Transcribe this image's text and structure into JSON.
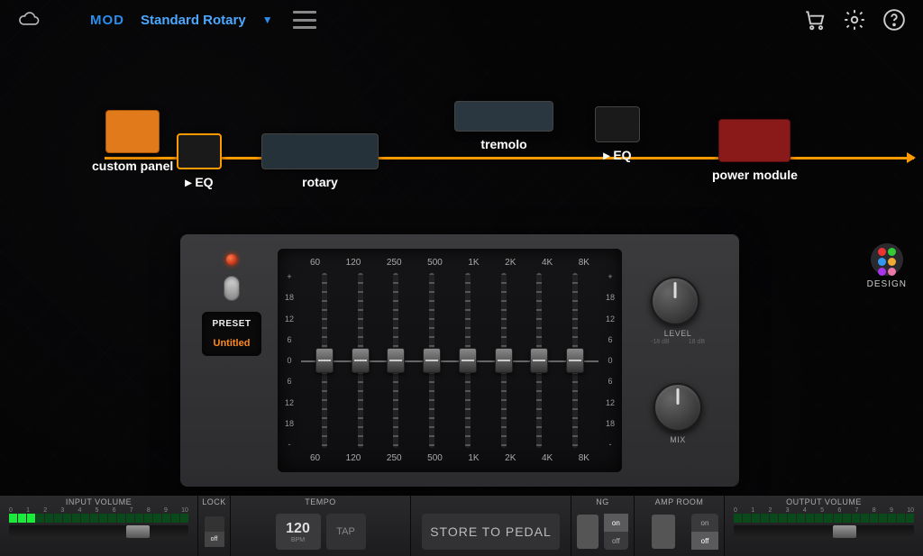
{
  "header": {
    "mod_label": "MOD",
    "preset_name": "Standard Rotary"
  },
  "chain": {
    "custom_panel": "custom panel",
    "eq1": "▸ EQ",
    "rotary": "rotary",
    "tremolo": "tremolo",
    "eq2": "▸ EQ",
    "power_module": "power module"
  },
  "design_button": "DESIGN",
  "eq_panel": {
    "preset_label": "PRESET",
    "preset_name": "Untitled",
    "db_plus": "+",
    "db_minus": "-",
    "db_top": "18",
    "db_mid1": "12",
    "db_mid2": "6",
    "db_zero": "0",
    "db_nmid2": "6",
    "db_nmid1": "12",
    "db_bot": "18",
    "freq": [
      "60",
      "120",
      "250",
      "500",
      "1K",
      "2K",
      "4K",
      "8K"
    ],
    "level_label": "LEVEL",
    "level_min": "-18 dB",
    "level_max": "18 dB",
    "mix_label": "MIX"
  },
  "bottombar": {
    "input_volume": "INPUT VOLUME",
    "tempo": "TEMPO",
    "ng": "NG",
    "amp_room": "AMP ROOM",
    "output_volume": "OUTPUT VOLUME",
    "scale": [
      "0",
      "1",
      "2",
      "3",
      "4",
      "5",
      "6",
      "7",
      "8",
      "9",
      "10"
    ],
    "lock_label": "LOCK",
    "lock_off": "off",
    "bpm_value": "120",
    "bpm_label": "BPM",
    "tap": "TAP",
    "store": "STORE TO PEDAL",
    "sw_on": "on",
    "sw_off": "off"
  }
}
